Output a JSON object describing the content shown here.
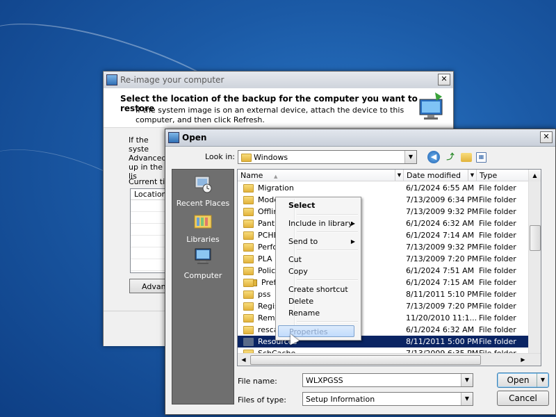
{
  "reimage": {
    "title": "Re-image your computer",
    "heading": "Select the location of the backup for the computer you want to restore",
    "description": "If the system image is on an external device, attach the device to this computer, and then click Refresh.",
    "body_text": "If the syste Advanced up in the lis",
    "current_time_label": "Current tim",
    "list_header": "Location",
    "advanced_button": "Advanc",
    "close": "✕"
  },
  "open_dialog": {
    "title": "Open",
    "close": "✕",
    "look_in_label": "Look in:",
    "look_in_value": "Windows",
    "places": [
      {
        "label": "Recent Places",
        "icon": "recent-places-icon"
      },
      {
        "label": "Libraries",
        "icon": "libraries-icon"
      },
      {
        "label": "Computer",
        "icon": "computer-icon"
      }
    ],
    "columns": {
      "name": "Name",
      "date": "Date modified",
      "type": "Type"
    },
    "files": [
      {
        "name": "Migration",
        "date": "6/1/2024 6:55 AM",
        "type": "File folder"
      },
      {
        "name": "Modem",
        "date": "7/13/2009 6:34 PM",
        "type": "File folder"
      },
      {
        "name": "Offline",
        "date": "7/13/2009 9:32 PM",
        "type": "File folder"
      },
      {
        "name": "Panthe",
        "date": "6/1/2024 6:32 AM",
        "type": "File folder"
      },
      {
        "name": "PCHEA",
        "date": "6/1/2024 7:14 AM",
        "type": "File folder"
      },
      {
        "name": "Perfor",
        "date": "7/13/2009 9:32 PM",
        "type": "File folder"
      },
      {
        "name": "PLA",
        "date": "7/13/2009 7:20 PM",
        "type": "File folder"
      },
      {
        "name": "PolicyD",
        "date": "6/1/2024 7:51 AM",
        "type": "File folder"
      },
      {
        "name": "Prefet",
        "date": "6/1/2024 7:15 AM",
        "type": "File folder",
        "locked": true
      },
      {
        "name": "pss",
        "date": "8/11/2011 5:10 PM",
        "type": "File folder"
      },
      {
        "name": "Regist",
        "date": "7/13/2009 7:20 PM",
        "type": "File folder"
      },
      {
        "name": "Remot",
        "date": "11/20/2010 11:1...",
        "type": "File folder"
      },
      {
        "name": "rescac",
        "date": "6/1/2024 6:32 AM",
        "type": "File folder"
      },
      {
        "name": "Resources",
        "date": "8/11/2011 5:00 PM",
        "type": "File folder",
        "selected": true
      },
      {
        "name": "SchCache",
        "date": "7/13/2009 6:35 PM",
        "type": "File folder"
      }
    ],
    "file_name_label": "File name:",
    "file_name_value": "WLXPGSS",
    "file_type_label": "Files of type:",
    "file_type_value": "Setup Information",
    "open_button": "Open",
    "cancel_button": "Cancel"
  },
  "context_menu": {
    "items": [
      {
        "label": "Select",
        "bold": true
      },
      {
        "label": "Include in library",
        "submenu": true
      },
      {
        "label": "Send to",
        "submenu": true
      },
      {
        "label": "Cut"
      },
      {
        "label": "Copy"
      },
      {
        "label": "Create shortcut"
      },
      {
        "label": "Delete"
      },
      {
        "label": "Rename"
      },
      {
        "label": "Properties",
        "highlighted": true
      }
    ]
  },
  "colors": {
    "selection": "#0a2463",
    "menu_highlight": "#c1dbfc",
    "desktop": "#1b5aa6"
  }
}
